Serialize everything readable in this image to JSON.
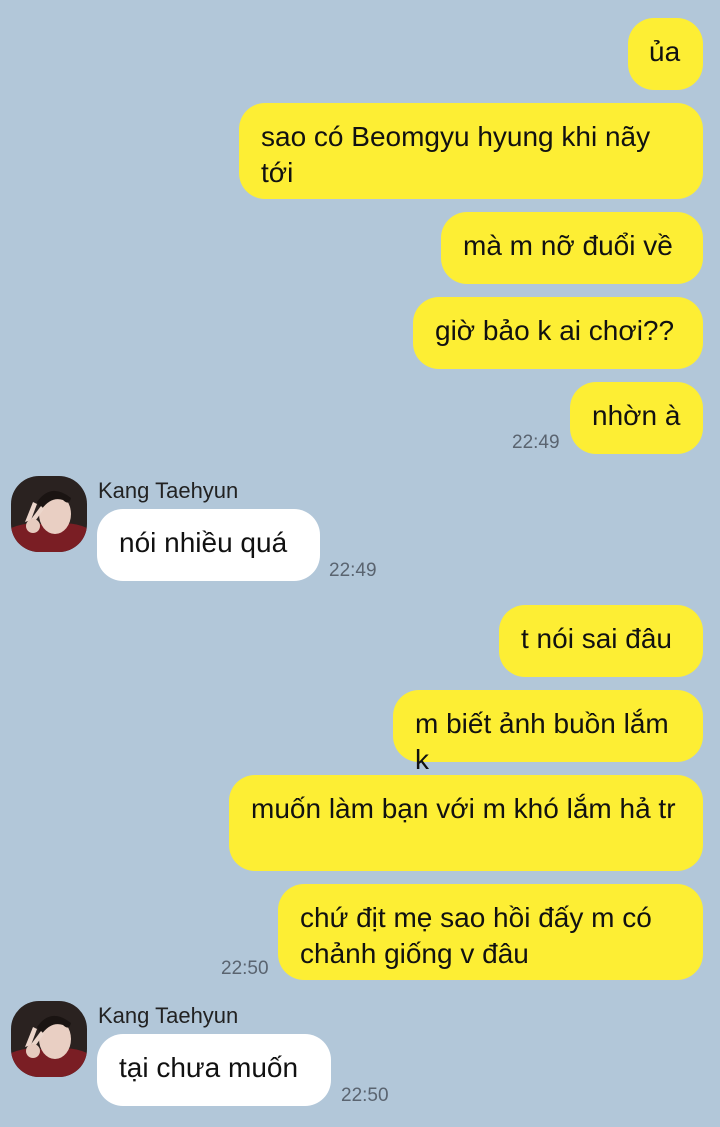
{
  "colors": {
    "background": "#b2c7d9",
    "my_bubble": "#fdee34",
    "their_bubble": "#ffffff",
    "timestamp": "#5a6470"
  },
  "messages": [
    {
      "from": "me",
      "text": "ủa"
    },
    {
      "from": "me",
      "text": "sao có Beomgyu hyung khi nãy tới"
    },
    {
      "from": "me",
      "text": "mà m nỡ đuổi về"
    },
    {
      "from": "me",
      "text": "giờ bảo k ai chơi??"
    },
    {
      "from": "me",
      "text": "nhờn à",
      "time": "22:49"
    },
    {
      "from": "them",
      "sender": "Kang Taehyun",
      "text": "nói nhiều quá",
      "time": "22:49"
    },
    {
      "from": "me",
      "text": "t nói sai đâu"
    },
    {
      "from": "me",
      "text": "m biết ảnh buồn lắm k"
    },
    {
      "from": "me",
      "text": "muốn làm bạn với m khó lắm hả tr"
    },
    {
      "from": "me",
      "text": "chứ địt mẹ sao hồi đấy m có chảnh giống v đâu",
      "time": "22:50"
    },
    {
      "from": "them",
      "sender": "Kang Taehyun",
      "text": "tại chưa muốn",
      "time": "22:50"
    }
  ]
}
